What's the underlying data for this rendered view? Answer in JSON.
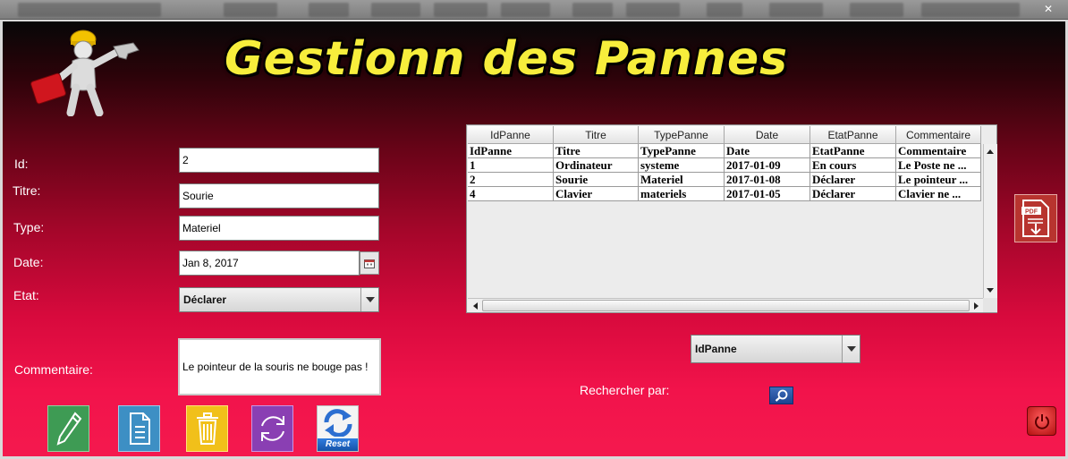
{
  "window": {
    "title": "Gestionn des Pannes",
    "close_symbol": "✕"
  },
  "form": {
    "id_label": "Id:",
    "id_value": "2",
    "titre_label": "Titre:",
    "titre_value": "Sourie",
    "type_label": "Type:",
    "type_value": "Materiel",
    "date_label": "Date:",
    "date_value": "Jan 8, 2017",
    "etat_label": "Etat:",
    "etat_value": "Déclarer",
    "commentaire_label": "Commentaire:",
    "commentaire_value": "Le pointeur de la souris ne bouge pas !"
  },
  "table": {
    "headers": [
      "IdPanne",
      "Titre",
      "TypePanne",
      "Date",
      "EtatPanne",
      "Commentaire"
    ],
    "rows": [
      [
        "IdPanne",
        "Titre",
        "TypePanne",
        "Date",
        "EtatPanne",
        "Commentaire"
      ],
      [
        "1",
        "Ordinateur",
        "systeme",
        "2017-01-09",
        "En cours",
        "Le Poste ne ..."
      ],
      [
        "2",
        "Sourie",
        "Materiel",
        "2017-01-08",
        "Déclarer",
        "Le pointeur ..."
      ],
      [
        "4",
        "Clavier",
        "materiels",
        "2017-01-05",
        "Déclarer",
        "Clavier  ne ..."
      ]
    ]
  },
  "search": {
    "field_value": "IdPanne",
    "label": "Rechercher par:"
  },
  "toolbar": {
    "reset_label": "Reset"
  },
  "icons": {
    "mascot": "mechanic-mascot-icon",
    "edit": "pencil-icon",
    "add": "document-icon",
    "delete": "trash-icon",
    "refresh": "refresh-icon",
    "reset": "reset-icon",
    "pdf": "pdf-icon",
    "search": "magnifier-icon",
    "exit": "power-icon",
    "calendar": "calendar-icon"
  },
  "colors": {
    "title": "#f7ee3c",
    "background_bottom": "#f4194e",
    "background_top": "#070707",
    "edit_button": "#3e9b54",
    "add_button": "#3d8fc4",
    "delete_button": "#f1c01a",
    "refresh_button": "#8a3fb3",
    "pdf_button": "#b8342f"
  }
}
